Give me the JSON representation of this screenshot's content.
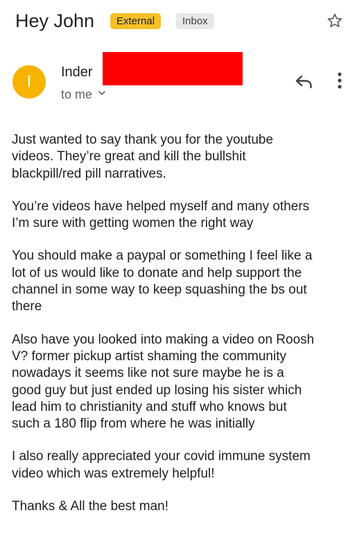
{
  "email": {
    "subject": "Hey John",
    "labels": {
      "external": "External",
      "inbox": "Inbox"
    },
    "sender": {
      "avatar_initial": "I",
      "name": "Inder",
      "recipient_text": "to me"
    },
    "body": [
      "Just wanted to say thank you for the youtube\nvideos. They’re great and kill the bullshit\nblackpill/red pill narratives.",
      "You’re videos have helped myself and many others\nI’m sure with getting women the right way",
      "You should make a paypal or something I feel like a\nlot of us would like to donate and help support the\nchannel in some way to keep squashing the bs out\nthere",
      "Also have you looked into making a video on Roosh\nV? former pickup artist shaming the community\nnowadays it seems like not sure maybe he is a\ngood guy but just ended up losing his sister which\nlead him to christianity and stuff who knows but\nsuch a 180 flip from where he was initially",
      "I also really appreciated your covid immune system\nvideo which was extremely  helpful!",
      "Thanks & All the best man!"
    ]
  },
  "icons": {
    "star": "star-outline-icon",
    "reply": "reply-icon",
    "more": "more-vert-icon",
    "expand": "chevron-down-icon"
  },
  "colors": {
    "external_badge": "#f6c026",
    "inbox_badge": "#e8e8e8",
    "avatar": "#f6b400",
    "redaction": "#ff0000",
    "secondary_text": "#5f6368"
  }
}
